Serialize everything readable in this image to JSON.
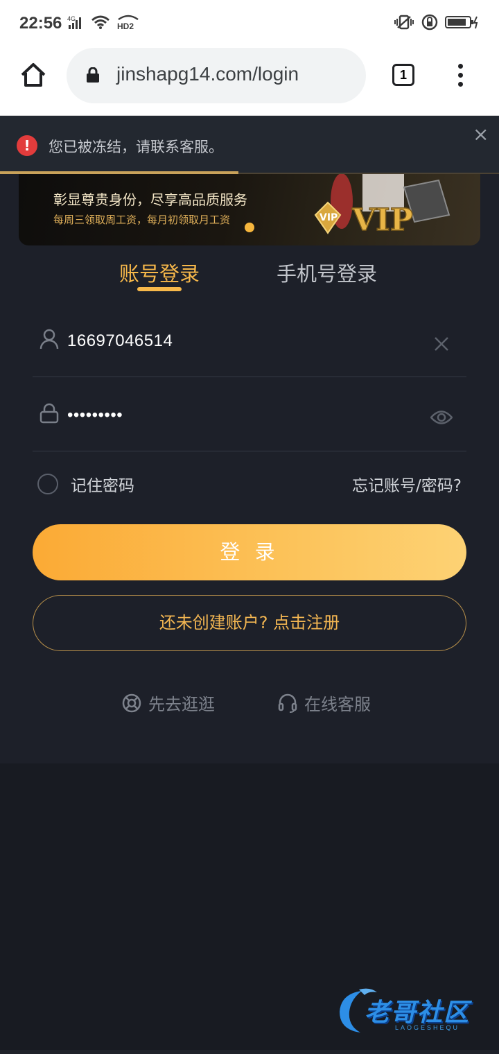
{
  "status_bar": {
    "time": "22:56",
    "network_label": "4G",
    "hd_label": "HD2"
  },
  "browser": {
    "url": "jinshapg14.com/login",
    "tab_count": "1"
  },
  "alert": {
    "message": "您已被冻结，请联系客服。",
    "close_glyph": "×"
  },
  "banner": {
    "headline": "彰显尊贵身份，尽享高品质服务",
    "subline": "每周三领取周工资，每月初领取月工资",
    "vip_badge": "VIP",
    "vip_big": "VIP"
  },
  "tabs": [
    {
      "label": "账号登录",
      "active": true
    },
    {
      "label": "手机号登录",
      "active": false
    }
  ],
  "form": {
    "username_value": "16697046514",
    "password_mask": "•••••••••",
    "remember_label": "记住密码",
    "forgot_label": "忘记账号/密码?",
    "login_label": "登 录",
    "register_label": "还未创建账户? 点击注册"
  },
  "bottom_links": {
    "browse_label": "先去逛逛",
    "service_label": "在线客服"
  },
  "watermark": {
    "text": "老哥社区",
    "sub": "LAOGESHEQU"
  },
  "colors": {
    "accent": "#f7b84a",
    "alert_red": "#e23c3c",
    "background": "#1d2029"
  }
}
